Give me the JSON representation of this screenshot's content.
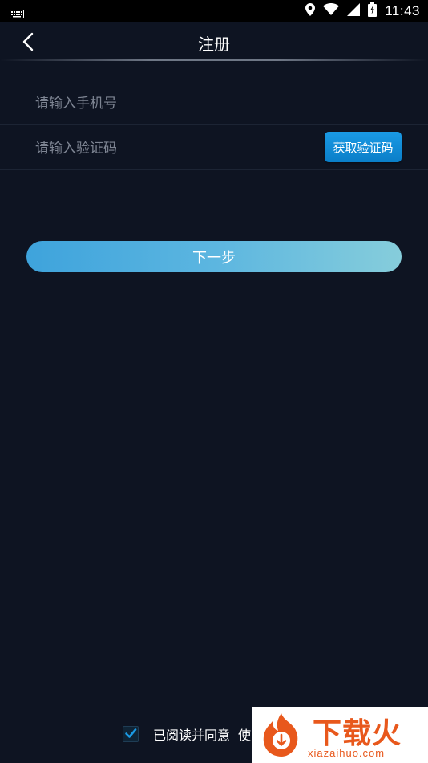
{
  "status_bar": {
    "time": "11:43"
  },
  "header": {
    "title": "注册"
  },
  "form": {
    "phone_placeholder": "请输入手机号",
    "code_placeholder": "请输入验证码",
    "get_code_label": "获取验证码",
    "next_label": "下一步"
  },
  "agreement": {
    "checked": true,
    "text": "已阅读并同意",
    "link": "使"
  },
  "watermark": {
    "brand": "下载火",
    "url": "xiazaihuo.com"
  },
  "colors": {
    "background": "#0e1422",
    "accent": "#1a9ae5",
    "watermark": "#e8581c"
  }
}
